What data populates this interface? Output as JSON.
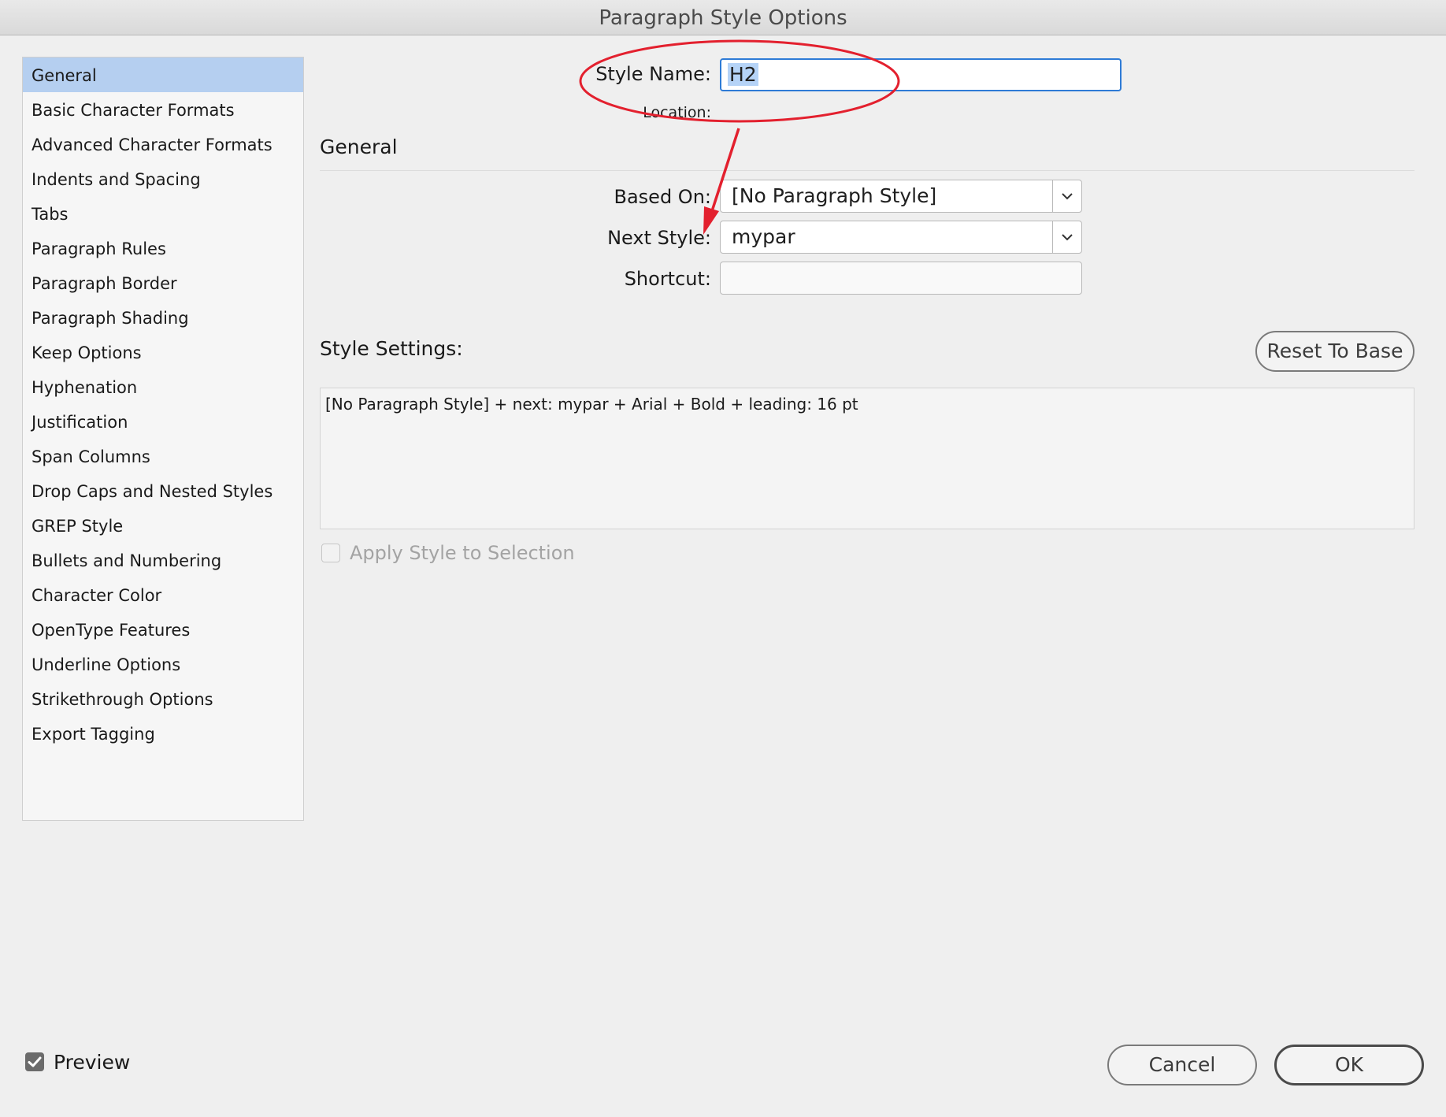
{
  "window": {
    "title": "Paragraph Style Options"
  },
  "sidebar": {
    "items": [
      {
        "label": "General",
        "selected": true
      },
      {
        "label": "Basic Character Formats"
      },
      {
        "label": "Advanced Character Formats"
      },
      {
        "label": "Indents and Spacing"
      },
      {
        "label": "Tabs"
      },
      {
        "label": "Paragraph Rules"
      },
      {
        "label": "Paragraph Border"
      },
      {
        "label": "Paragraph Shading"
      },
      {
        "label": "Keep Options"
      },
      {
        "label": "Hyphenation"
      },
      {
        "label": "Justification"
      },
      {
        "label": "Span Columns"
      },
      {
        "label": "Drop Caps and Nested Styles"
      },
      {
        "label": "GREP Style"
      },
      {
        "label": "Bullets and Numbering"
      },
      {
        "label": "Character Color"
      },
      {
        "label": "OpenType Features"
      },
      {
        "label": "Underline Options"
      },
      {
        "label": "Strikethrough Options"
      },
      {
        "label": "Export Tagging"
      }
    ]
  },
  "form": {
    "style_name_label": "Style Name:",
    "style_name_value": "H2",
    "location_label": "Location:",
    "section_title": "General",
    "based_on_label": "Based On:",
    "based_on_value": "[No Paragraph Style]",
    "next_style_label": "Next Style:",
    "next_style_value": "mypar",
    "shortcut_label": "Shortcut:",
    "shortcut_value": ""
  },
  "style_settings": {
    "label": "Style Settings:",
    "reset_button": "Reset To Base",
    "description": "[No Paragraph Style] + next: mypar + Arial + Bold + leading: 16 pt"
  },
  "apply_style": {
    "label": "Apply Style to Selection",
    "checked": false,
    "enabled": false
  },
  "footer": {
    "preview_label": "Preview",
    "preview_checked": true,
    "cancel_label": "Cancel",
    "ok_label": "OK"
  },
  "colors": {
    "selection": "#b5cff0",
    "focus": "#2e7bd6",
    "annotation": "#e3202e",
    "checkbox_checked": "#6b6b6b"
  },
  "icons": {
    "dropdown": "chevron-down-icon",
    "checkbox_checked": "checkmark-icon"
  }
}
